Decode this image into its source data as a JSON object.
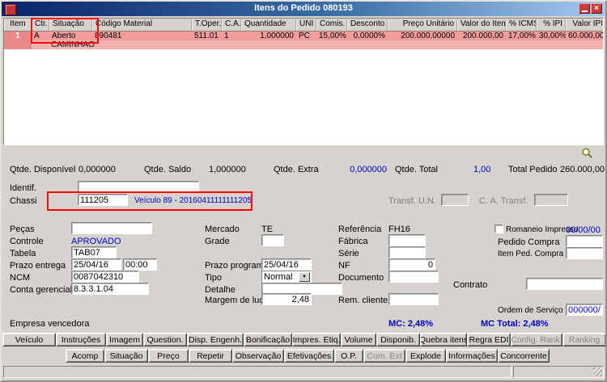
{
  "window": {
    "title": "Itens do Pedido 080193"
  },
  "icons": {
    "close": "×",
    "combo_arrow": "▼"
  },
  "grid": {
    "headers": [
      "Item",
      "Ctr.",
      "Situação",
      "Código Material",
      "T.Oper.",
      "C.A.",
      "Quantidade",
      "UNI",
      "Comis.",
      "Desconto",
      "Preço Unitário",
      "Valor do Item",
      "% ICMS",
      "% IPI",
      "Valor IPI"
    ],
    "row": [
      "1",
      "A",
      "Aberto",
      "890481",
      "511.01",
      "1",
      "1,000000",
      "PC",
      "15,00%",
      "0,0000%",
      "200.000,00000",
      "200.000,00",
      "17,00%",
      "30,00%",
      "60.000,00"
    ],
    "subrow": "CAMINHAO"
  },
  "summary": {
    "disponivel_label": "Qtde. Disponível",
    "disponivel_value": "0,000000",
    "saldo_label": "Qtde. Saldo",
    "saldo_value": "1,000000",
    "extra_label": "Qtde. Extra",
    "extra_value": "0,000000",
    "total_label": "Qtde. Total",
    "total_value": "1,00",
    "total_pedido_label": "Total Pedido",
    "total_pedido_value": "260.000,00"
  },
  "fields": {
    "identif_label": "Identif.",
    "chassi_label": "Chassi",
    "chassi_value": "111205",
    "chassi_desc": "Veículo 89 - 20160411111111205",
    "transf_un_label": "Transf. U.N.",
    "ca_transf_label": "C. A. Transf.",
    "pecas_label": "Peças",
    "mercado_label": "Mercado",
    "mercado_value": "TE",
    "referencia_label": "Referência",
    "referencia_value": "FH16",
    "romaneio_label": "Romaneio Impresso",
    "romaneio_value": "00/00/00",
    "controle_label": "Controle",
    "controle_value": "APROVADO",
    "grade_label": "Grade",
    "fabrica_label": "Fábrica",
    "pedido_compra_label": "Pedido Compra",
    "tabela_label": "Tabela",
    "tabela_value": "TAB07",
    "serie_label": "Série",
    "item_ped_compra_label": "Item Ped. Compra",
    "prazo_entrega_label": "Prazo entrega",
    "prazo_entrega_date": "25/04/16",
    "prazo_entrega_time": "00:00",
    "prazo_programado_label": "Prazo programado",
    "prazo_programado_value": "25/04/16",
    "nf_label": "NF",
    "nf_value": "0",
    "ncm_label": "NCM",
    "ncm_value": "0087042310",
    "tipo_label": "Tipo",
    "tipo_value": "Normal",
    "documento_label": "Documento",
    "conta_gerencial_label": "Conta gerencial",
    "conta_gerencial_value": "8.3.3.1.04",
    "detalhe_label": "Detalhe",
    "contrato_label": "Contrato",
    "margem_label": "Margem de lucro",
    "margem_value": "2,48",
    "rem_cliente_label": "Rem. cliente",
    "ordem_servico_label": "Ordem de Serviço",
    "ordem_servico_value": "000000/"
  },
  "footer": {
    "empresa_label": "Empresa vencedora",
    "mc": "MC: 2,48%",
    "mc_total": "MC Total: 2,48%"
  },
  "buttons": {
    "row1": [
      "Veículo",
      "Instruções",
      "Imagem",
      "Question.",
      "Disp. Engenh.",
      "Bonificação",
      "Impres. Etiq.",
      "Volume",
      "Disponib.",
      "Quebra itens",
      "Regra EDI",
      "Config. Rank.",
      "Ranking"
    ],
    "row2": [
      "Acomp",
      "Situação",
      "Preço",
      "Repetir",
      "Observação",
      "Efetivações",
      "O.P.",
      "Com. Ext",
      "Explode",
      "Informações",
      "Concorrente"
    ]
  }
}
